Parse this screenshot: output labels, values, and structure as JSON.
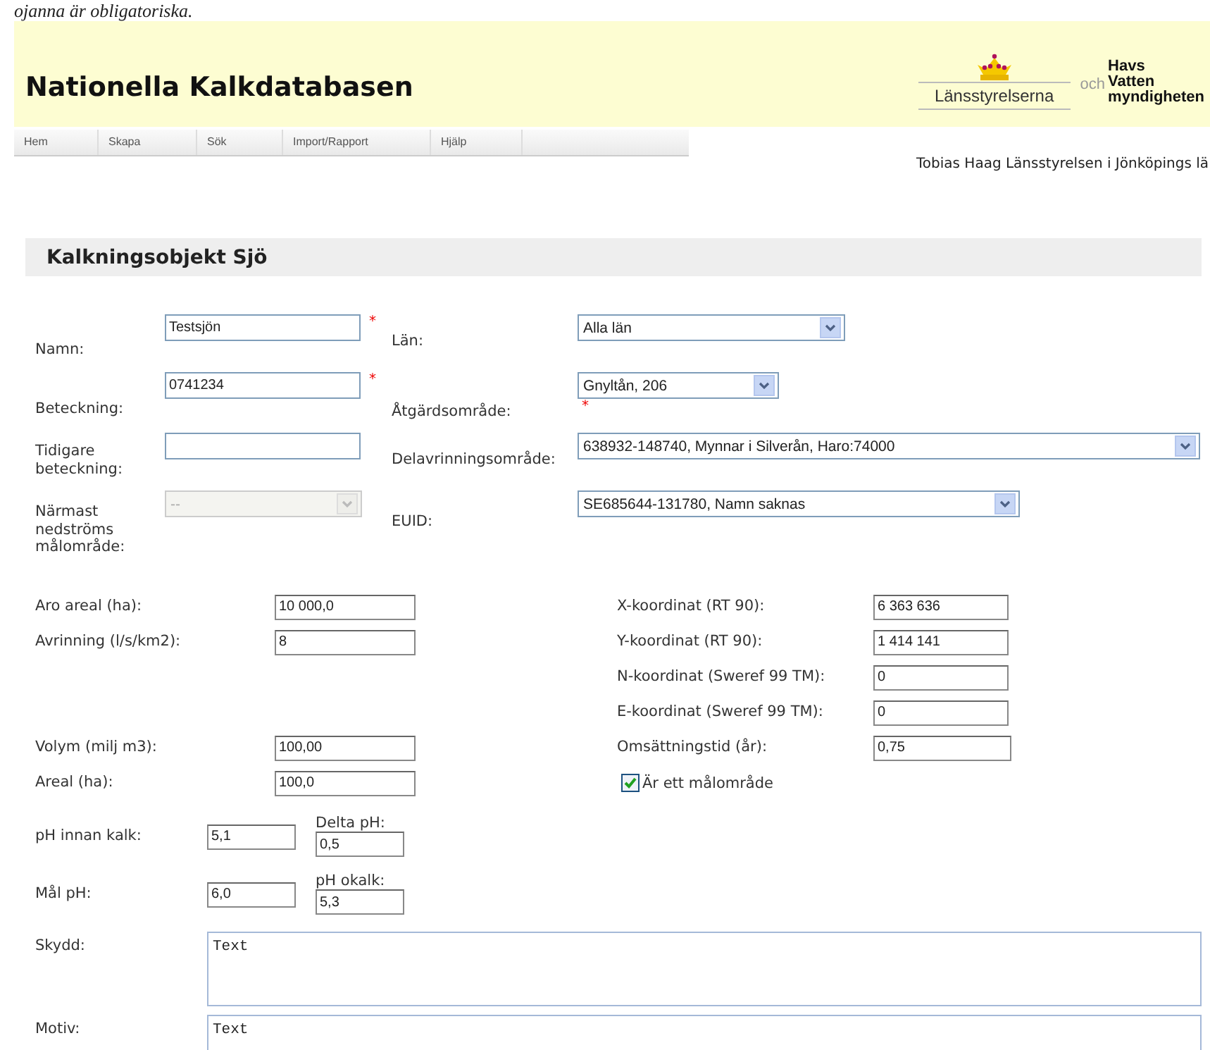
{
  "top_caption": "ojanna är obligatoriska.",
  "header": {
    "title": "Nationella Kalkdatabasen",
    "county_logo_text": "Länsstyrelserna",
    "och": "och",
    "agency_logo_lines": [
      "Havs",
      "Vatten",
      "myndigheten"
    ]
  },
  "nav": [
    {
      "label": "Hem"
    },
    {
      "label": "Skapa"
    },
    {
      "label": "Sök"
    },
    {
      "label": "Import/Rapport"
    },
    {
      "label": "Hjälp"
    }
  ],
  "user": "Tobias Haag Länsstyrelsen i Jönköpings lä",
  "section_title": "Kalkningsobjekt Sjö",
  "left_fields": [
    {
      "label": "Namn:",
      "kind": "input",
      "value": "Testsjön",
      "required_mark": "*",
      "disabled": false
    },
    {
      "label": "Beteckning:",
      "kind": "input",
      "value": "0741234",
      "required_mark": "*",
      "disabled": false
    },
    {
      "label": "Tidigare beteckning:",
      "kind": "input",
      "disabled": false
    },
    {
      "label": "Närmast nedströms målområde:",
      "kind": "select",
      "value": "--",
      "disabled": true
    }
  ],
  "right_fields": [
    {
      "label": "Län:",
      "kind": "select",
      "value": "Alla län"
    },
    {
      "label": "Åtgärdsområde:",
      "kind": "select",
      "value": "Gnyltån, 206",
      "required_mark": "*"
    },
    {
      "label": "Delavrinningsområde:",
      "kind": "select",
      "value": "638932-148740, Mynnar i Silverån, Haro:74000"
    },
    {
      "label": "EUID:",
      "kind": "select",
      "value": "SE685644-131780, Namn saknas"
    }
  ],
  "flow_fields": [
    {
      "label": "Aro areal (ha):",
      "value": "10 000,0"
    },
    {
      "label": "Avrinning (l/s/km2):",
      "value": "8"
    }
  ],
  "volume_fields": [
    {
      "label": "Volym (milj m3):",
      "value": "100,00"
    },
    {
      "label": "Areal (ha):",
      "value": "100,0"
    }
  ],
  "coordinate_fields": [
    {
      "label": "X-koordinat (RT 90):",
      "value": "6 363 636"
    },
    {
      "label": "Y-koordinat (RT 90):",
      "value": "1 414 141"
    },
    {
      "label": "N-koordinat (Sweref 99 TM):",
      "value": "0"
    },
    {
      "label": "E-koordinat (Sweref 99 TM):",
      "value": "0"
    },
    {
      "label": "Omsättningstid (år):",
      "value": "0,75"
    }
  ],
  "target_area_checkbox": {
    "label": "Är ett målområde",
    "checked": true
  },
  "ph_rows": [
    {
      "label": "pH innan kalk:",
      "value": "5,1",
      "side_label": "Delta pH:",
      "side_value": "0,5"
    },
    {
      "label": "Mål pH:",
      "value": "6,0",
      "side_label": "pH okalk:",
      "side_value": "5,3"
    }
  ],
  "text_areas": [
    {
      "label": "Skydd:",
      "value": "Text"
    },
    {
      "label": "Motiv:",
      "value": "Text"
    }
  ]
}
